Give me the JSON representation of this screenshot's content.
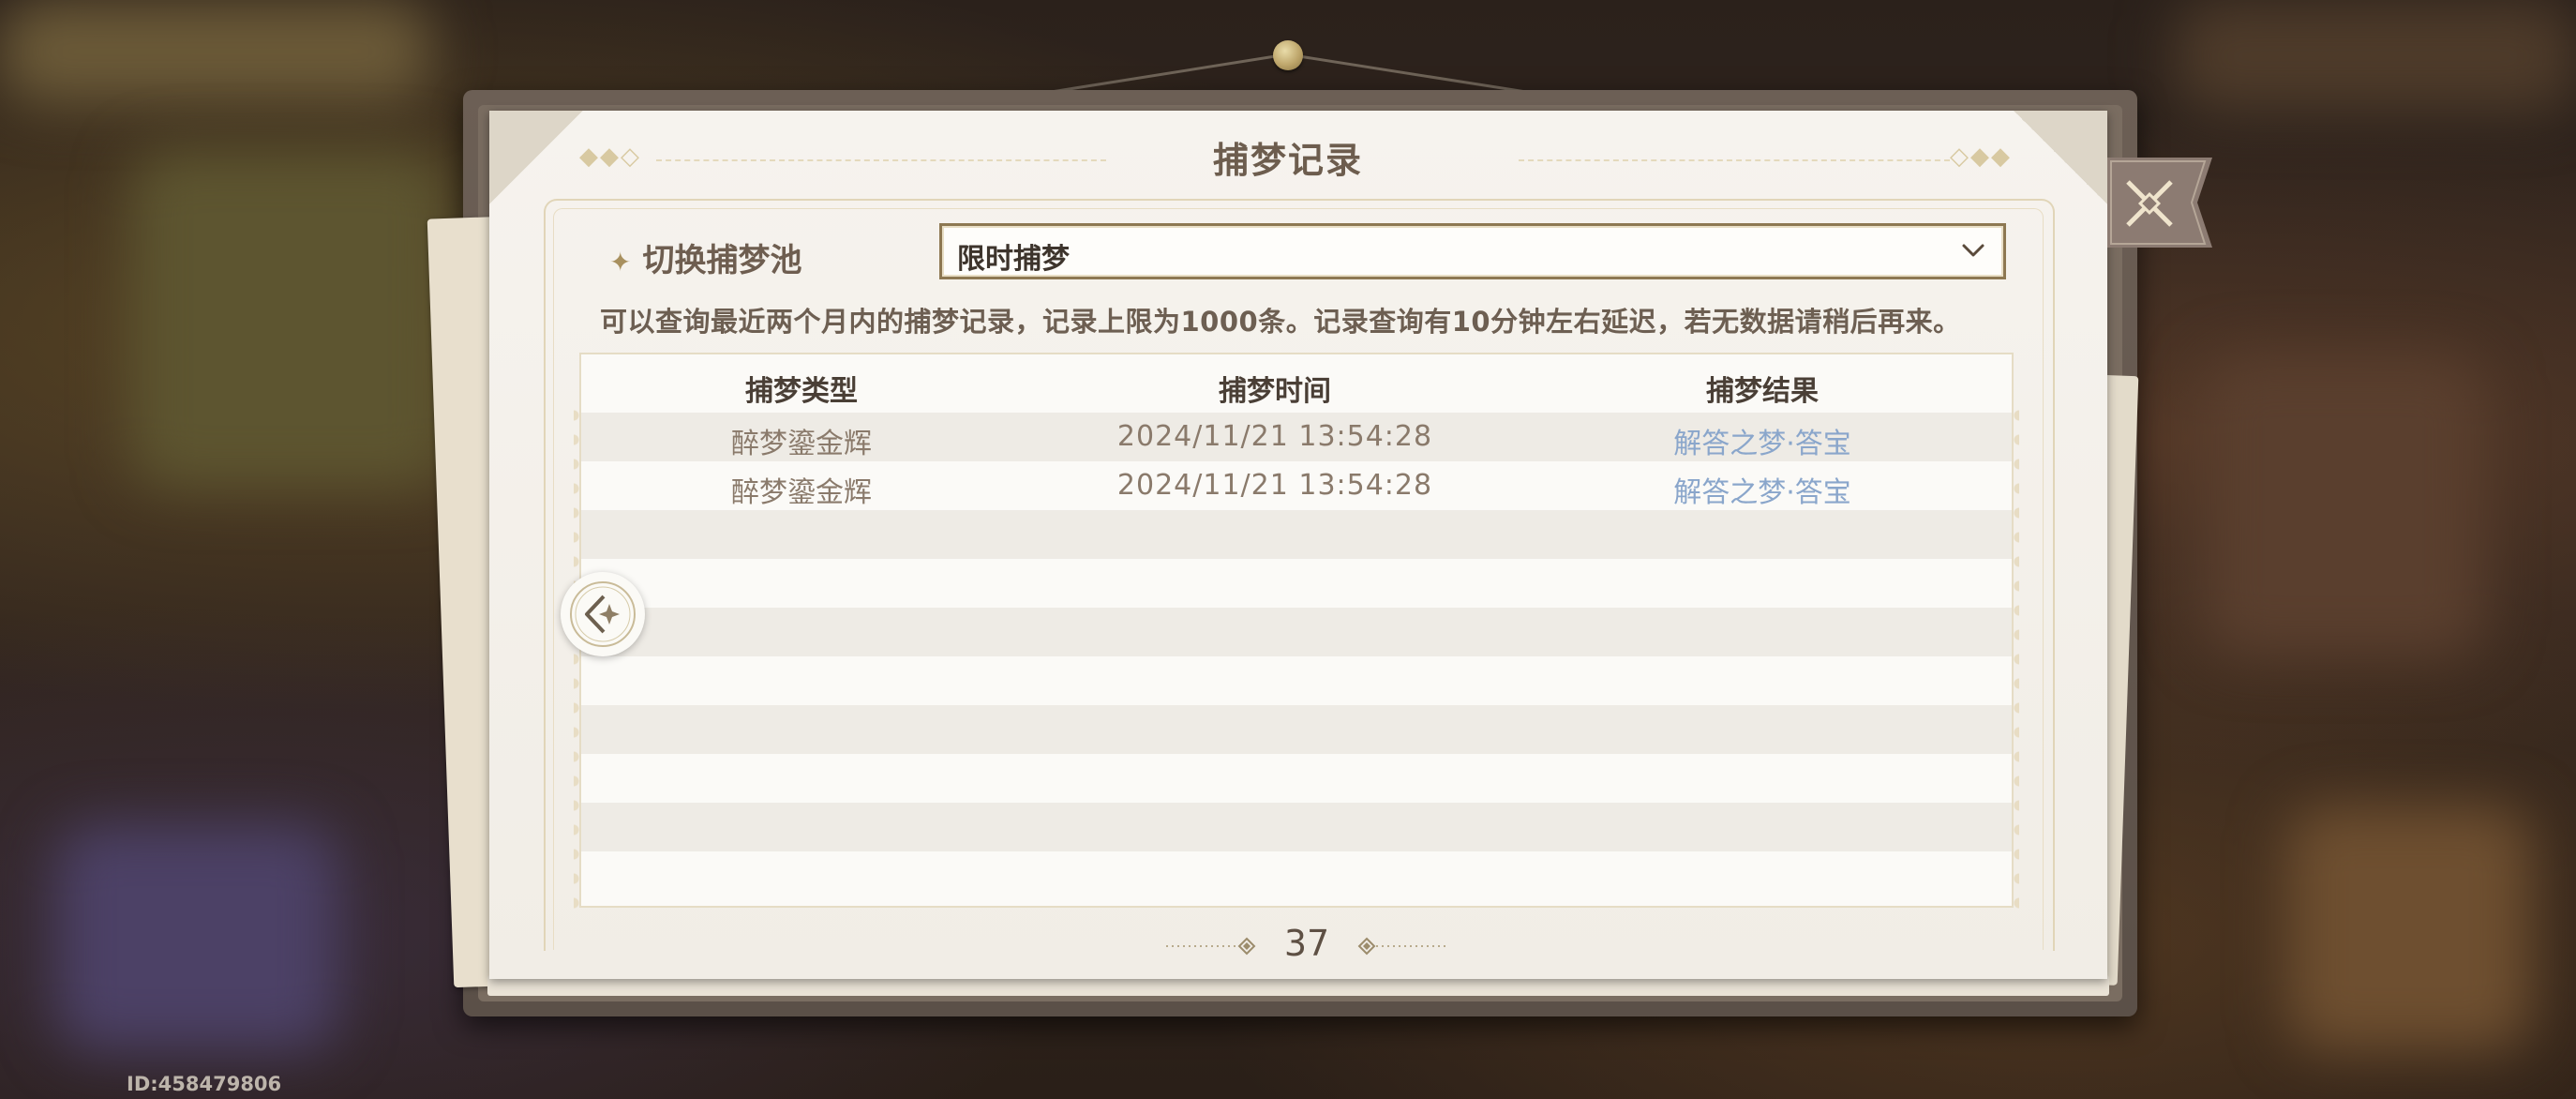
{
  "window": {
    "title": "捕梦记录"
  },
  "pool_switch": {
    "label": "切换捕梦池",
    "selected": "限时捕梦",
    "icon": "star-icon",
    "dropdown_icon": "chevron-down-icon"
  },
  "notice": "可以查询最近两个月内的捕梦记录，记录上限为1000条。记录查询有10分钟左右延迟，若无数据请稍后再来。",
  "table": {
    "headers": [
      "捕梦类型",
      "捕梦时间",
      "捕梦结果"
    ],
    "rows": [
      {
        "type": "醉梦鎏金辉",
        "time": "2024/11/21 13:54:28",
        "result": "解答之梦·答宝"
      },
      {
        "type": "醉梦鎏金辉",
        "time": "2024/11/21 13:54:28",
        "result": "解答之梦·答宝"
      }
    ],
    "result_color": "#8aa6cb"
  },
  "pagination": {
    "page": "37"
  },
  "back_button": {
    "icon": "back-arrow-icon"
  },
  "close_button": {
    "icon": "close-icon"
  },
  "footer": {
    "id": "ID:458479806"
  },
  "colors": {
    "accent": "#8d7852",
    "title": "#6d5d4e",
    "paper": "#f6f3ee"
  }
}
